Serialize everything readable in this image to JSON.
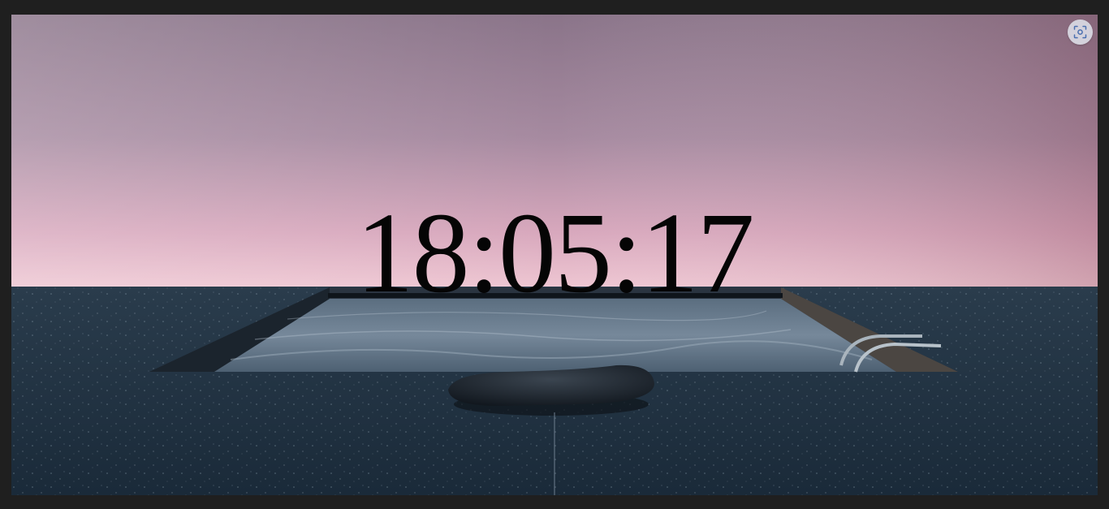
{
  "clock": {
    "time": "18:05:17"
  },
  "controls": {
    "focus_button_icon": "scan-focus-icon"
  },
  "colors": {
    "sky_top": "#8a7488",
    "sky_bottom": "#e7b7c7",
    "horizon_glow": "#c47a8c",
    "floor": "#1e2f3f",
    "clock_text": "#050505",
    "button_bg": "#e1e4ec",
    "button_icon": "#4a6fb0"
  }
}
